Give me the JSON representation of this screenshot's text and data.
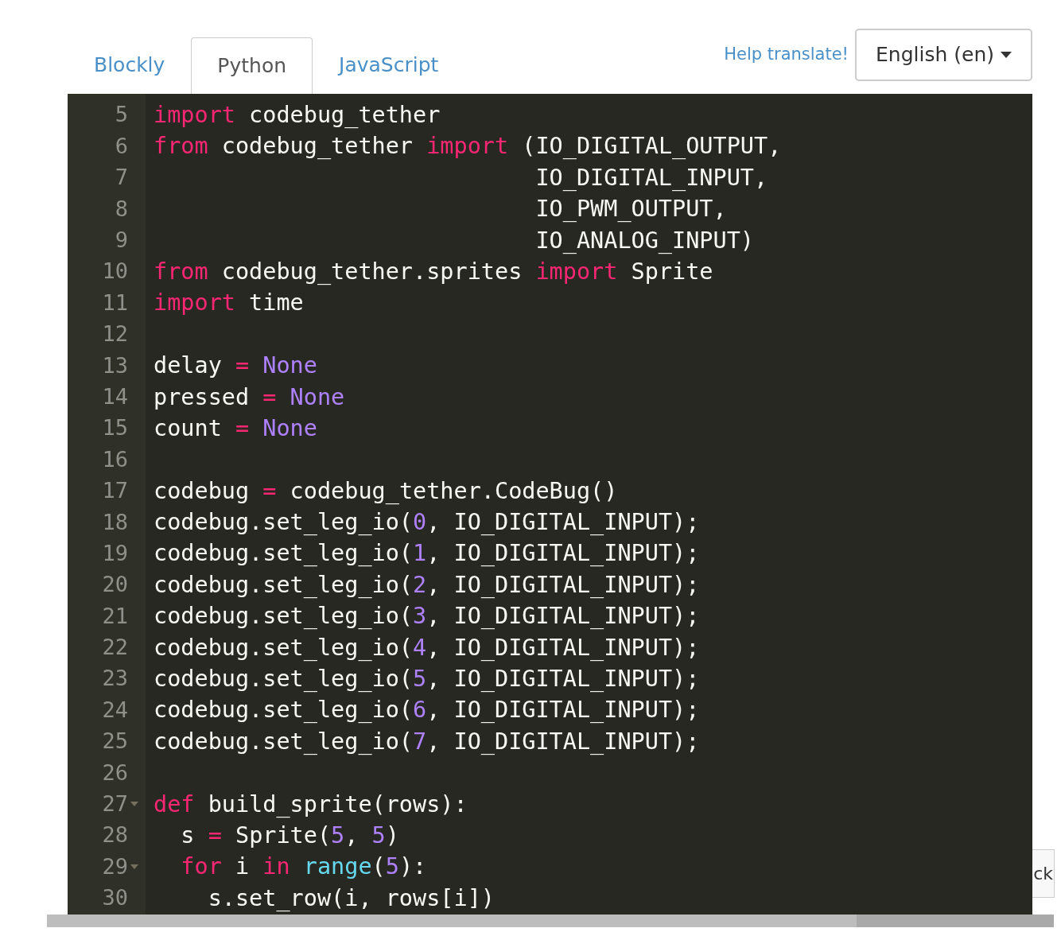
{
  "tabs": [
    {
      "label": "Blockly",
      "selected": false
    },
    {
      "label": "Python",
      "selected": true
    },
    {
      "label": "JavaScript",
      "selected": false
    }
  ],
  "help_link": "Help translate!",
  "language_button": "English (en)",
  "side_button": "ck",
  "editor": {
    "lines": [
      {
        "number": "5",
        "foldable": false,
        "tokens": [
          {
            "kind": "keyword",
            "text": "import"
          },
          {
            "kind": "plain",
            "text": " codebug_tether"
          }
        ]
      },
      {
        "number": "6",
        "foldable": false,
        "tokens": [
          {
            "kind": "keyword",
            "text": "from"
          },
          {
            "kind": "plain",
            "text": " codebug_tether "
          },
          {
            "kind": "keyword",
            "text": "import"
          },
          {
            "kind": "plain",
            "text": " (IO_DIGITAL_OUTPUT,"
          }
        ]
      },
      {
        "number": "7",
        "foldable": false,
        "tokens": [
          {
            "kind": "plain",
            "text": "                            IO_DIGITAL_INPUT,"
          }
        ]
      },
      {
        "number": "8",
        "foldable": false,
        "tokens": [
          {
            "kind": "plain",
            "text": "                            IO_PWM_OUTPUT,"
          }
        ]
      },
      {
        "number": "9",
        "foldable": false,
        "tokens": [
          {
            "kind": "plain",
            "text": "                            IO_ANALOG_INPUT)"
          }
        ]
      },
      {
        "number": "10",
        "foldable": false,
        "tokens": [
          {
            "kind": "keyword",
            "text": "from"
          },
          {
            "kind": "plain",
            "text": " codebug_tether.sprites "
          },
          {
            "kind": "keyword",
            "text": "import"
          },
          {
            "kind": "plain",
            "text": " Sprite"
          }
        ]
      },
      {
        "number": "11",
        "foldable": false,
        "tokens": [
          {
            "kind": "keyword",
            "text": "import"
          },
          {
            "kind": "plain",
            "text": " time"
          }
        ]
      },
      {
        "number": "12",
        "foldable": false
      },
      {
        "number": "13",
        "foldable": false,
        "tokens": [
          {
            "kind": "plain",
            "text": "delay "
          },
          {
            "kind": "operator",
            "text": "="
          },
          {
            "kind": "constant",
            "text": " None"
          }
        ]
      },
      {
        "number": "14",
        "foldable": false,
        "tokens": [
          {
            "kind": "plain",
            "text": "pressed "
          },
          {
            "kind": "operator",
            "text": "="
          },
          {
            "kind": "constant",
            "text": " None"
          }
        ]
      },
      {
        "number": "15",
        "foldable": false,
        "tokens": [
          {
            "kind": "plain",
            "text": "count "
          },
          {
            "kind": "operator",
            "text": "="
          },
          {
            "kind": "constant",
            "text": " None"
          }
        ]
      },
      {
        "number": "16",
        "foldable": false
      },
      {
        "number": "17",
        "foldable": false,
        "tokens": [
          {
            "kind": "plain",
            "text": "codebug "
          },
          {
            "kind": "operator",
            "text": "="
          },
          {
            "kind": "plain",
            "text": " codebug_tether.CodeBug()"
          }
        ]
      },
      {
        "number": "18",
        "foldable": false,
        "tokens": [
          {
            "kind": "plain",
            "text": "codebug.set_leg_io("
          },
          {
            "kind": "constant",
            "text": "0"
          },
          {
            "kind": "plain",
            "text": ", IO_DIGITAL_INPUT);"
          }
        ]
      },
      {
        "number": "19",
        "foldable": false,
        "tokens": [
          {
            "kind": "plain",
            "text": "codebug.set_leg_io("
          },
          {
            "kind": "constant",
            "text": "1"
          },
          {
            "kind": "plain",
            "text": ", IO_DIGITAL_INPUT);"
          }
        ]
      },
      {
        "number": "20",
        "foldable": false,
        "tokens": [
          {
            "kind": "plain",
            "text": "codebug.set_leg_io("
          },
          {
            "kind": "constant",
            "text": "2"
          },
          {
            "kind": "plain",
            "text": ", IO_DIGITAL_INPUT);"
          }
        ]
      },
      {
        "number": "21",
        "foldable": false,
        "tokens": [
          {
            "kind": "plain",
            "text": "codebug.set_leg_io("
          },
          {
            "kind": "constant",
            "text": "3"
          },
          {
            "kind": "plain",
            "text": ", IO_DIGITAL_INPUT);"
          }
        ]
      },
      {
        "number": "22",
        "foldable": false,
        "tokens": [
          {
            "kind": "plain",
            "text": "codebug.set_leg_io("
          },
          {
            "kind": "constant",
            "text": "4"
          },
          {
            "kind": "plain",
            "text": ", IO_DIGITAL_INPUT);"
          }
        ]
      },
      {
        "number": "23",
        "foldable": false,
        "tokens": [
          {
            "kind": "plain",
            "text": "codebug.set_leg_io("
          },
          {
            "kind": "constant",
            "text": "5"
          },
          {
            "kind": "plain",
            "text": ", IO_DIGITAL_INPUT);"
          }
        ]
      },
      {
        "number": "24",
        "foldable": false,
        "tokens": [
          {
            "kind": "plain",
            "text": "codebug.set_leg_io("
          },
          {
            "kind": "constant",
            "text": "6"
          },
          {
            "kind": "plain",
            "text": ", IO_DIGITAL_INPUT);"
          }
        ]
      },
      {
        "number": "25",
        "foldable": false,
        "tokens": [
          {
            "kind": "plain",
            "text": "codebug.set_leg_io("
          },
          {
            "kind": "constant",
            "text": "7"
          },
          {
            "kind": "plain",
            "text": ", IO_DIGITAL_INPUT);"
          }
        ]
      },
      {
        "number": "26",
        "foldable": false
      },
      {
        "number": "27",
        "foldable": true,
        "tokens": [
          {
            "kind": "keyword",
            "text": "def"
          },
          {
            "kind": "plain",
            "text": " build_sprite(rows):"
          }
        ]
      },
      {
        "number": "28",
        "foldable": false,
        "tokens": [
          {
            "kind": "plain",
            "text": "  s "
          },
          {
            "kind": "operator",
            "text": "="
          },
          {
            "kind": "plain",
            "text": " Sprite("
          },
          {
            "kind": "constant",
            "text": "5"
          },
          {
            "kind": "plain",
            "text": ", "
          },
          {
            "kind": "constant",
            "text": "5"
          },
          {
            "kind": "plain",
            "text": ")"
          }
        ]
      },
      {
        "number": "29",
        "foldable": true,
        "tokens": [
          {
            "kind": "keyword",
            "text": "  for"
          },
          {
            "kind": "plain",
            "text": " i "
          },
          {
            "kind": "keyword",
            "text": "in"
          },
          {
            "kind": "builtin",
            "text": " range"
          },
          {
            "kind": "plain",
            "text": "("
          },
          {
            "kind": "constant",
            "text": "5"
          },
          {
            "kind": "plain",
            "text": "):"
          }
        ]
      },
      {
        "number": "30",
        "foldable": false,
        "tokens": [
          {
            "kind": "plain",
            "text": "    s.set_row(i, rows[i])"
          }
        ]
      }
    ]
  }
}
